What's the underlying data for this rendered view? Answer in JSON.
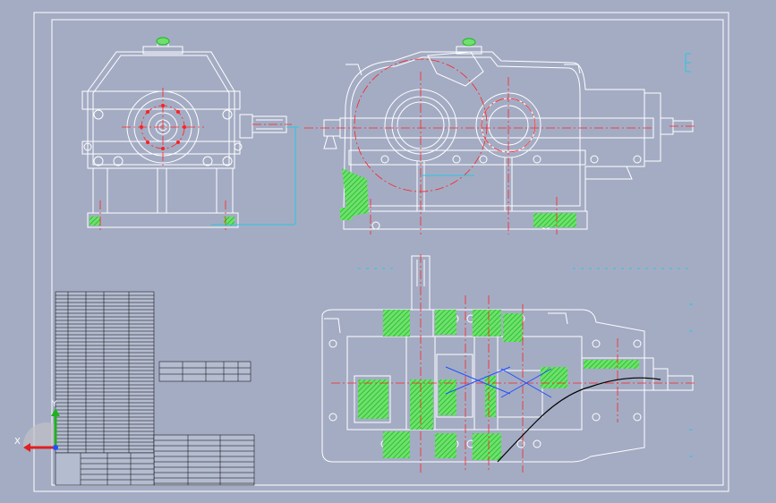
{
  "viewport": {
    "background": "#a4acc4"
  },
  "colors": {
    "line": "#ffffff",
    "center": "#ff2020",
    "hatch": "#22dd22",
    "dim": "#24c8e0",
    "axis_x": "#e02020",
    "axis_y": "#20b020",
    "axis_z": "#2050ff",
    "break": "#000000"
  },
  "axis_triad": {
    "x_label": "X",
    "y_label": "Y"
  }
}
